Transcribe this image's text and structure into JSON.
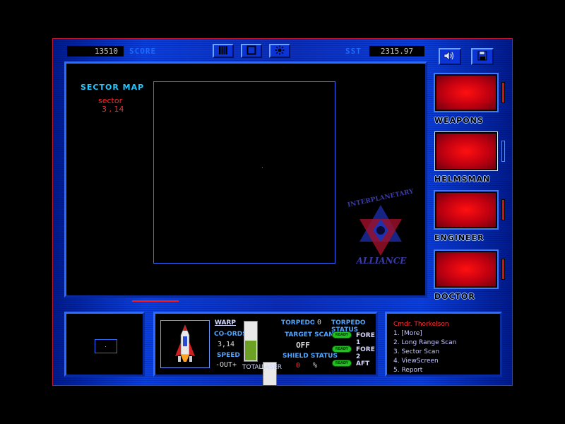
{
  "top": {
    "score_value": "13510",
    "score_label": "SCORE",
    "sst_label": "SST",
    "sst_value": "2315.97"
  },
  "sector": {
    "title": "SECTOR MAP",
    "label": "sector",
    "coords": "3 , 14"
  },
  "emblem": {
    "line1": "INTERPLANETARY",
    "line2": "ALLIANCE"
  },
  "crew": [
    {
      "label": "WEAPONS",
      "indicator": "red"
    },
    {
      "label": "HELMSMAN",
      "indicator": "off"
    },
    {
      "label": "ENGINEER",
      "indicator": "red"
    },
    {
      "label": "DOCTOR",
      "indicator": "red"
    }
  ],
  "nav": {
    "warp_label": "WARP",
    "coords_label": "CO-ORDS",
    "coords_value": "3,14",
    "speed_label": "SPEED",
    "speed_value": "-OUT+",
    "total_label": "TOTAL",
    "laser_label": "LASER",
    "total_level": 0.5,
    "laser_level": 0.0
  },
  "weapons": {
    "torpedoes_label": "TORPEDOES",
    "torpedoes_value": "0",
    "target_scan_label": "TARGET SCAN",
    "target_scan_value": "OFF",
    "shield_label": "SHIELD STATUS",
    "shield_value": "0",
    "shield_unit": "%",
    "torpedo_status_label": "TORPEDO STATUS",
    "ready_text": "READY",
    "tubes": [
      "FORE 1",
      "FORE 2",
      "AFT"
    ]
  },
  "menu": {
    "header": "Cmdr. Thorkelson",
    "items": [
      "1. [More]",
      "2. Long Range Scan",
      "3. Sector Scan",
      "4. ViewScreen",
      "5. Report"
    ]
  },
  "colors": {
    "frame_border": "#c0142a",
    "accent_blue": "#2a6cff",
    "alert_red": "#ff2a2a",
    "ready_green": "#20c020"
  }
}
